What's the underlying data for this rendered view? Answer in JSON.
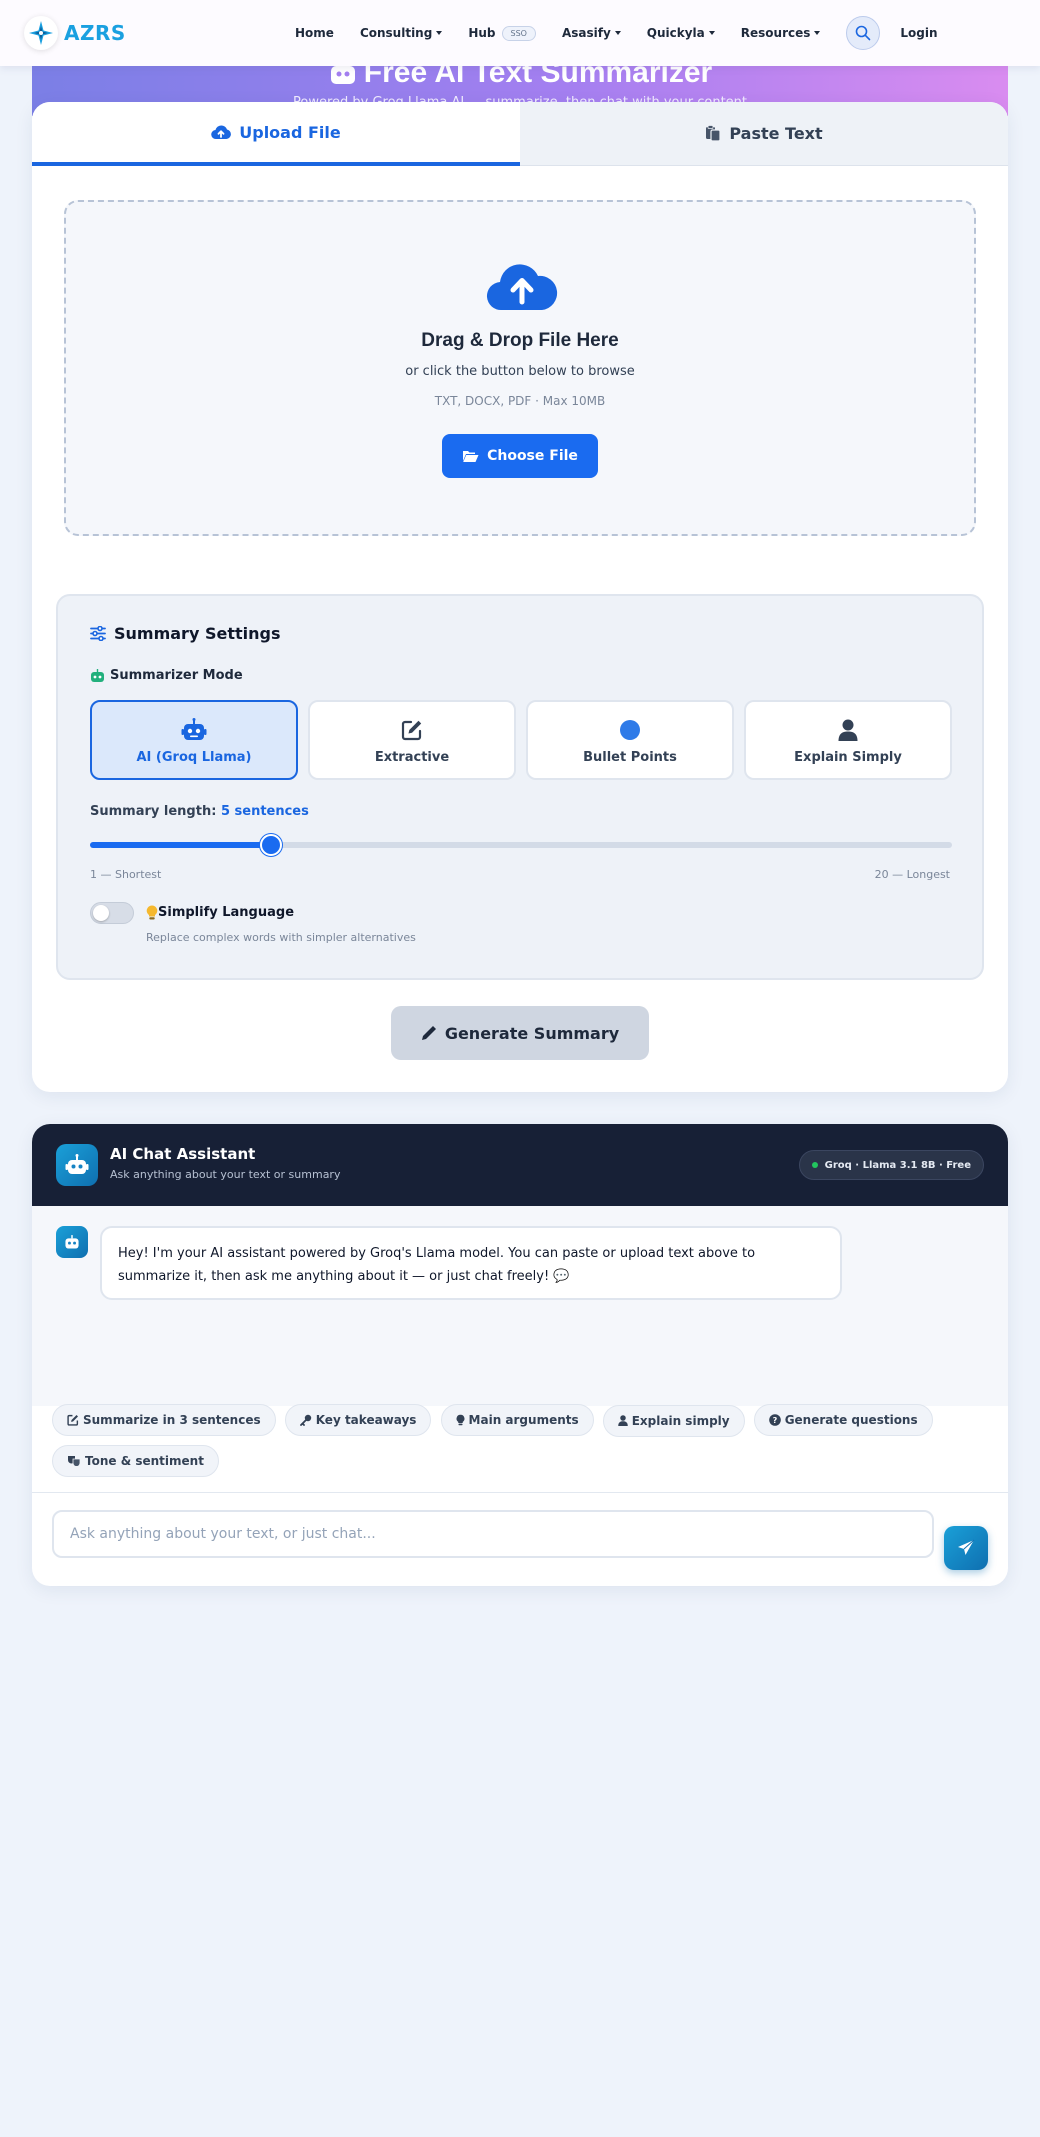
{
  "nav": {
    "brand": "AZRS",
    "items": [
      {
        "label": "Home",
        "caret": false
      },
      {
        "label": "Consulting",
        "caret": true
      },
      {
        "label": "Hub",
        "caret": false,
        "badge": "SSO"
      },
      {
        "label": "Asasify",
        "caret": true
      },
      {
        "label": "Quickyla",
        "caret": true
      },
      {
        "label": "Resources",
        "caret": true
      }
    ],
    "login": "Login"
  },
  "hero": {
    "title": "Free AI Text Summarizer",
    "subtitle": "Powered by Groq Llama AI — summarize, then chat with your content"
  },
  "tabs": {
    "upload": "Upload File",
    "paste": "Paste Text"
  },
  "dropzone": {
    "title": "Drag & Drop File Here",
    "subtitle": "or click the button below to browse",
    "types": "TXT, DOCX, PDF · Max 10MB",
    "button": "Choose File"
  },
  "settings": {
    "title": "Summary Settings",
    "mode_label": "Summarizer Mode",
    "modes": [
      {
        "label": "AI (Groq Llama)",
        "icon": "robot-icon",
        "active": true
      },
      {
        "label": "Extractive",
        "icon": "edit-icon",
        "active": false
      },
      {
        "label": "Bullet Points",
        "icon": "circle-icon",
        "active": false
      },
      {
        "label": "Explain Simply",
        "icon": "user-icon",
        "active": false
      }
    ],
    "length_label": "Summary length:",
    "length_value": "5 sentences",
    "slider": {
      "min": 1,
      "max": 20,
      "value": 5
    },
    "min_label": "1 — Shortest",
    "max_label": "20 — Longest",
    "simplify_label": "Simplify Language",
    "simplify_desc": "Replace complex words with simpler alternatives",
    "simplify_on": false
  },
  "generate_button": "Generate Summary",
  "chat": {
    "title": "AI Chat Assistant",
    "subtitle": "Ask anything about your text or summary",
    "model_badge": "Groq · Llama 3.1 8B · Free",
    "greeting": "Hey! I'm your AI assistant powered by Groq's Llama model. You can paste or upload text above to summarize it, then ask me anything about it — or just chat freely! 💬",
    "chips": [
      {
        "label": "Summarize in 3 sentences",
        "icon": "edit-icon"
      },
      {
        "label": "Key takeaways",
        "icon": "key-icon"
      },
      {
        "label": "Main arguments",
        "icon": "lightbulb-icon"
      },
      {
        "label": "Explain simply",
        "icon": "user-icon"
      },
      {
        "label": "Generate questions",
        "icon": "question-icon"
      },
      {
        "label": "Tone & sentiment",
        "icon": "masks-icon"
      }
    ],
    "input_placeholder": "Ask anything about your text, or just chat..."
  },
  "colors": {
    "accent": "#1a66e0",
    "brand": "#1aa0e0",
    "chat_header": "#172036"
  }
}
